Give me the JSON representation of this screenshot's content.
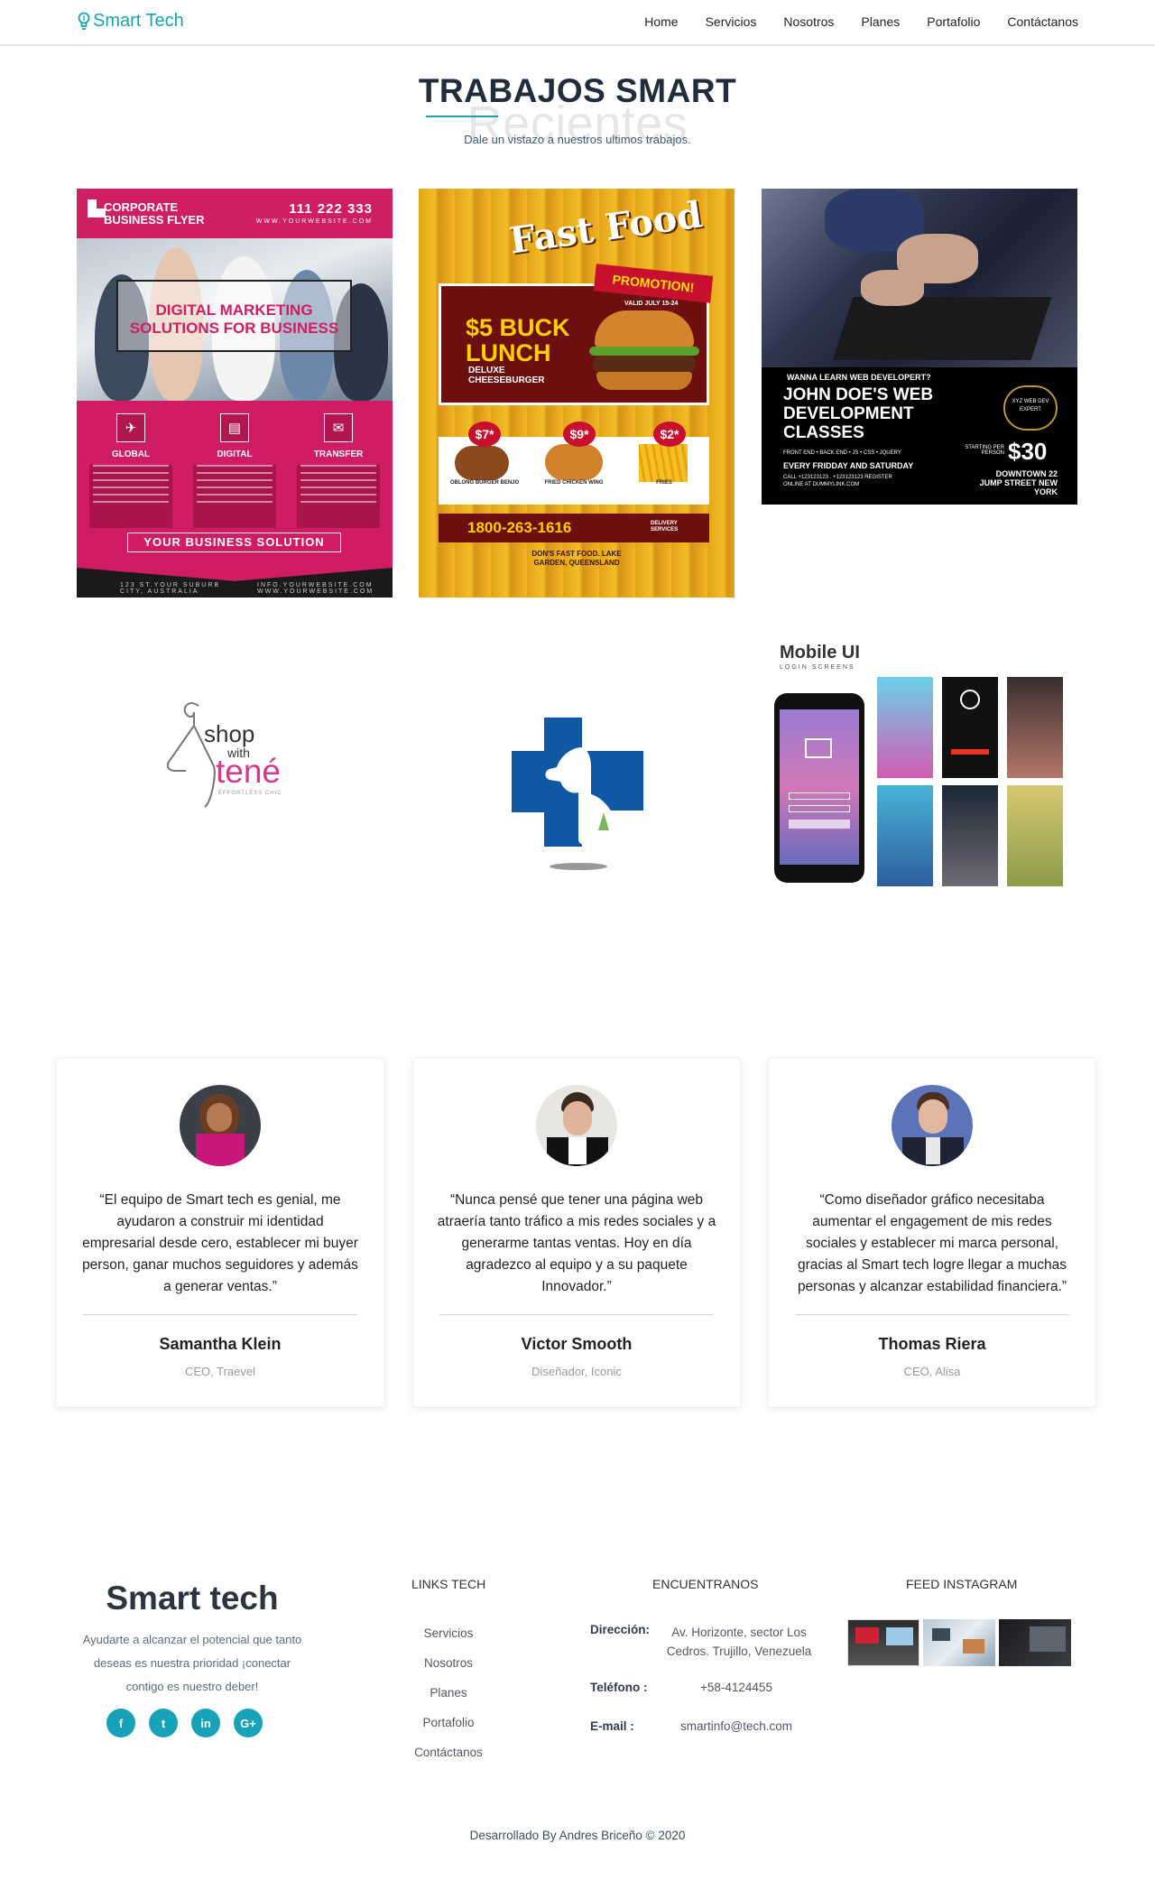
{
  "nav": {
    "brand": "Smart Tech",
    "links": [
      "Home",
      "Servicios",
      "Nosotros",
      "Planes",
      "Portafolio",
      "Contáctanos"
    ]
  },
  "portfolio": {
    "title": "TRABAJOS SMART",
    "ghost": "Recientes",
    "subtitle": "Dale un vistazo a nuestros ultimos trabajos.",
    "flyer1": {
      "corp": "CORPORATE\nBUSINESS FLYER",
      "phone": "111 222 333",
      "site": "WWW.YOURWEBSITE.COM",
      "headline": "DIGITAL MARKETING SOLUTIONS FOR BUSINESS",
      "cols": [
        "GLOBAL",
        "DIGITAL",
        "TRANSFER"
      ],
      "solution": "YOUR BUSINESS SOLUTION",
      "foot_left": "123 ST.YOUR SUBURB CITY, AUSTRALIA",
      "foot_right": "INFO.YOURWEBSITE.COM WWW.YOURWEBSITE.COM"
    },
    "flyer2": {
      "title": "Fast Food",
      "promo": "PROMOTION!",
      "valid": "VALID JULY 15-24",
      "buck": "$5 BUCK LUNCH",
      "deluxe": "DELUXE CHEESEBURGER",
      "prices": [
        "$7*",
        "$9*",
        "$2*"
      ],
      "foods": [
        "OBLONG BURGER BENJO",
        "FRIED CHICKEN WING",
        "FRIES"
      ],
      "phone": "1800-263-1616",
      "delivery": "DELIVERY SERVICES",
      "address": "DON'S FAST FOOD. LAKE GARDEN, QUEENSLAND"
    },
    "flyer3": {
      "wanna": "WANNA LEARN WEB DEVELOPERT?",
      "name": "JOHN DOE'S WEB DEVELOPMENT CLASSES",
      "tags": "FRONT END  •  BACK END  •  JS  •  CSS  •  JQUERY",
      "every": "EVERY FRIDDAY AND SATURDAY",
      "call": "CALL +123123123 . +123123123 REGISTER ONLINE AT  DUMMYLINK.COM",
      "badge": "XYZ WEB DEV EXPERT",
      "starting": "STARTING PER PERSON",
      "price": "$30",
      "location": "DOWNTOWN 22 JUMP STREET NEW YORK"
    },
    "shop": {
      "line1": "shop",
      "line2": "with",
      "line3": "tené",
      "tagline": "EFFORTLESS CHIC"
    },
    "mobile": {
      "title": "Mobile UI",
      "subtitle": "LOGIN SCREENS"
    }
  },
  "testimonials": [
    {
      "quote": "“El equipo de Smart tech es genial, me ayudaron a construir mi identidad empresarial desde cero, establecer mi buyer person, ganar muchos seguidores y además a generar ventas.”",
      "name": "Samantha Klein",
      "role": "CEO, Traevel"
    },
    {
      "quote": "“Nunca pensé que tener una página web atraería tanto tráfico a mis redes sociales y a generarme tantas ventas. Hoy en día agradezco al equipo y a su paquete Innovador.”",
      "name": "Victor Smooth",
      "role": "Diseñador, Iconic"
    },
    {
      "quote": "“Como diseñador gráfico necesitaba aumentar el engagement de mis redes sociales y establecer mi marca personal, gracias al Smart tech logre llegar a muchas personas y alcanzar estabilidad financiera.”",
      "name": "Thomas Riera",
      "role": "CEO, Alisa"
    }
  ],
  "footer": {
    "brand": "Smart tech",
    "desc": "Ayudarte a alcanzar el potencial que tanto deseas es nuestra prioridad ¡conectar contigo es nuestro deber!",
    "social": [
      "f",
      "t",
      "in",
      "G+"
    ],
    "links_title": "LINKS TECH",
    "links": [
      "Servicios",
      "Nosotros",
      "Planes",
      "Portafolio",
      "Contáctanos"
    ],
    "contact_title": "ENCUENTRANOS",
    "address_label": "Dirección:",
    "address": "Av. Horizonte, sector Los Cedros. Trujillo, Venezuela",
    "phone_label": "Teléfono :",
    "phone": "+58-4124455",
    "email_label": "E-mail :",
    "email": "smartinfo@tech.com",
    "insta_title": "FEED INSTAGRAM",
    "copyright": "Desarrollado By Andres Briceño © 2020"
  },
  "colors": {
    "accent": "#17a2b8",
    "flyer_pink": "#cf1e63",
    "flyer_maroon": "#6d0f0f"
  }
}
